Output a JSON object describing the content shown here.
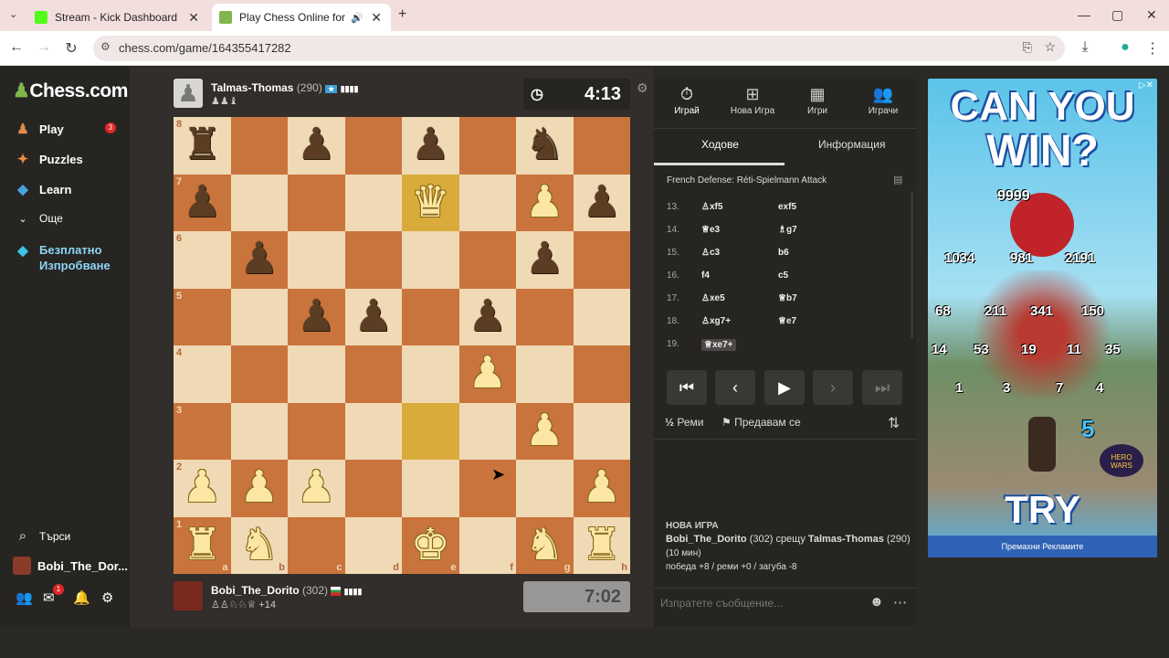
{
  "browser": {
    "tabs": [
      {
        "title": "Stream - Kick Dashboard",
        "favicon_color": "#53fc18"
      },
      {
        "title": "Play Chess Online for FREE",
        "favicon_color": "#81b64c"
      }
    ],
    "url": "chess.com/game/164355417282"
  },
  "sidebar": {
    "logo": "Chess.com",
    "items": [
      {
        "label": "Play",
        "icon": "play-pawn-icon",
        "badge": "3"
      },
      {
        "label": "Puzzles",
        "icon": "puzzle-icon"
      },
      {
        "label": "Learn",
        "icon": "learn-icon"
      },
      {
        "label": "Още",
        "icon": "chevron-down-icon"
      },
      {
        "label": "Безплатно Изпробване",
        "icon": "diamond-icon"
      }
    ],
    "search_label": "Търси",
    "username": "Bobi_The_Dor...",
    "mail_badge": "1"
  },
  "top_player": {
    "name": "Talmas-Thomas",
    "rating": "(290)",
    "clock": "4:13",
    "captured": "♟♟♝"
  },
  "bottom_player": {
    "name": "Bobi_The_Dorito",
    "rating": "(302)",
    "clock": "7:02",
    "captured": "♙♙♘♘♕",
    "advantage": "+14"
  },
  "board": {
    "files": [
      "a",
      "b",
      "c",
      "d",
      "e",
      "f",
      "g",
      "h"
    ],
    "ranks": [
      "8",
      "7",
      "6",
      "5",
      "4",
      "3",
      "2",
      "1"
    ],
    "light_color": "#f0d9b5",
    "dark_color": "#c9743c",
    "highlight_color": "#d9ab3a"
  },
  "panel": {
    "tabs": [
      {
        "label": "Играй",
        "icon": "timer-icon"
      },
      {
        "label": "Нова Игра",
        "icon": "plus-icon"
      },
      {
        "label": "Игри",
        "icon": "board-icon"
      },
      {
        "label": "Играчи",
        "icon": "players-icon"
      }
    ],
    "subtabs": [
      "Ходове",
      "Информация"
    ],
    "opening": "French Defense: Réti-Spielmann Attack",
    "moves": [
      {
        "n": "13.",
        "w": "♙xf5",
        "b": "exf5"
      },
      {
        "n": "14.",
        "w": "♕e3",
        "b": "♗g7"
      },
      {
        "n": "15.",
        "w": "♙c3",
        "b": "b6"
      },
      {
        "n": "16.",
        "w": "f4",
        "b": "c5"
      },
      {
        "n": "17.",
        "w": "♙xe5",
        "b": "♕b7"
      },
      {
        "n": "18.",
        "w": "♙xg7+",
        "b": "♕e7"
      },
      {
        "n": "19.",
        "w": "♕xe7+",
        "b": ""
      }
    ],
    "draw_label": "Реми",
    "draw_icon": "½",
    "resign_label": "Предавам се",
    "new_game": {
      "heading": "НОВА ИГРА",
      "p1": "Bobi_The_Dorito",
      "p1_rating": "(302)",
      "vs": "срещу",
      "p2": "Talmas-Thomas",
      "p2_rating": "(290)",
      "duration": "(10 мин)",
      "result": "победа +8 / реми +0 / загуба -8"
    },
    "chat_placeholder": "Изпратете съобщение..."
  },
  "ad": {
    "headline1": "CAN YOU",
    "headline2": "WIN?",
    "numbers": [
      "9999",
      "1034",
      "981",
      "2191",
      "68",
      "211",
      "341",
      "150",
      "14",
      "53",
      "19",
      "11",
      "35",
      "1",
      "3",
      "7",
      "4",
      "5"
    ],
    "cta": "TRY",
    "brand": "HERO WARS",
    "remove": "Премахни Рекламите"
  }
}
